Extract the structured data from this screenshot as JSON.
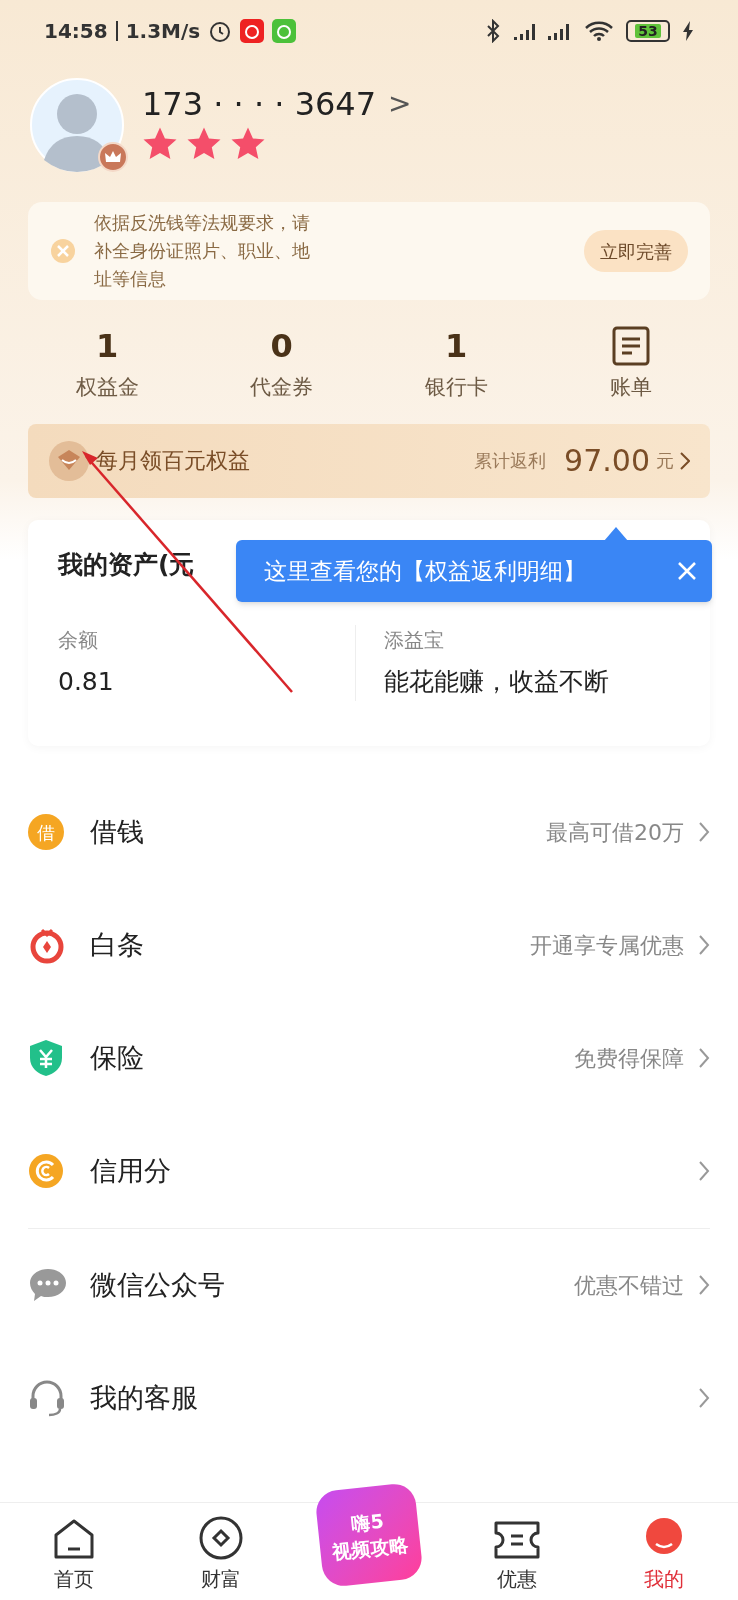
{
  "status_bar": {
    "time": "14:58",
    "speed": "1.3M/s",
    "battery": "53"
  },
  "profile": {
    "phone": "173 · · · · 3647",
    "chevron": ">",
    "stars": 3
  },
  "notice": {
    "text": "依据反洗钱等法规要求，请补全身份证照片、职业、地址等信息",
    "button": "立即完善"
  },
  "stats": [
    {
      "kind": "count",
      "value": "1",
      "label": "权益金"
    },
    {
      "kind": "count",
      "value": "0",
      "label": "代金券"
    },
    {
      "kind": "count",
      "value": "1",
      "label": "银行卡"
    },
    {
      "kind": "icon",
      "label": "账单"
    }
  ],
  "benefit_bar": {
    "title": "每月领百元权益",
    "caption": "累计返利",
    "amount": "97.00",
    "unit": "元"
  },
  "tooltip": {
    "text": "这里查看您的【权益返利明细】"
  },
  "assets": {
    "title": "我的资产(元",
    "items": [
      {
        "label": "余额",
        "value": "0.81"
      },
      {
        "label": "添益宝",
        "value": "能花能赚，收益不断"
      }
    ]
  },
  "menu": [
    {
      "kind": "loan",
      "label": "借钱",
      "detail": "最高可借20万",
      "badge": "借"
    },
    {
      "kind": "baitiao",
      "label": "白条",
      "detail": "开通享专属优惠"
    },
    {
      "kind": "insurance",
      "label": "保险",
      "detail": "免费得保障"
    },
    {
      "kind": "credit",
      "label": "信用分"
    },
    {
      "kind": "wechat",
      "label": "微信公众号",
      "detail": "优惠不错过"
    },
    {
      "kind": "service",
      "label": "我的客服"
    }
  ],
  "tab_bar": [
    {
      "kind": "home",
      "label": "首页",
      "selected": false
    },
    {
      "kind": "wealth",
      "label": "财富",
      "selected": false
    },
    {
      "kind": "promo",
      "label": "嗨5 视频攻略",
      "selected": false
    },
    {
      "kind": "coupon",
      "label": "优惠",
      "selected": false
    },
    {
      "kind": "mine",
      "label": "我的",
      "selected": true
    }
  ]
}
